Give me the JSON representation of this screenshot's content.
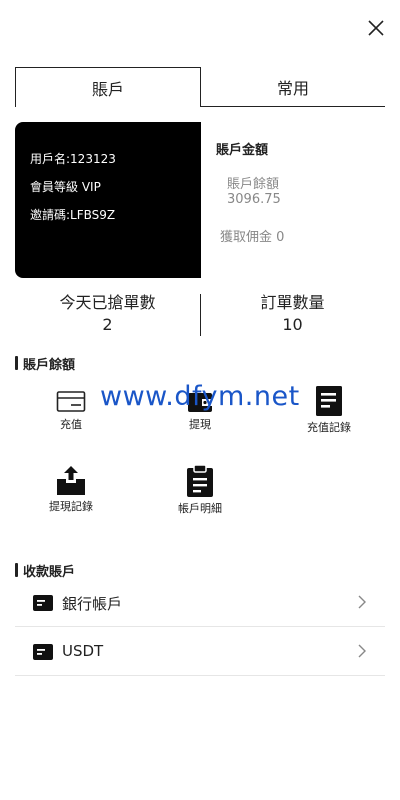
{
  "tabs": {
    "account": "賬戶",
    "common": "常用"
  },
  "card": {
    "username": "用戶名:123123",
    "level": "會員等級 VIP",
    "invite": "邀請碼:LFBS9Z"
  },
  "amount": {
    "title": "賬戶金額",
    "balance_label": "賬戶餘額",
    "balance_value": "3096.75",
    "commission": "獲取佣金 0"
  },
  "stats": {
    "grabbed_label": "今天已搶單數",
    "grabbed_value": "2",
    "orders_label": "訂單數量",
    "orders_value": "10"
  },
  "balance_section": {
    "title": "賬戶餘額",
    "items": [
      {
        "label": "充值",
        "icon": "card-icon"
      },
      {
        "label": "提現",
        "icon": "wallet-icon"
      },
      {
        "label": "充值記錄",
        "icon": "document-icon"
      },
      {
        "label": "提現記錄",
        "icon": "upload-tray-icon"
      },
      {
        "label": "帳戶明細",
        "icon": "clipboard-icon"
      }
    ]
  },
  "watermark": "www.dfym.net",
  "receive_section": {
    "title": "收款賬戶",
    "rows": [
      {
        "label": "銀行帳戶"
      },
      {
        "label": "USDT"
      }
    ]
  },
  "colors": {
    "card_bg": "#000000",
    "watermark": "#1a56c8",
    "divider": "#e6e6e6"
  }
}
